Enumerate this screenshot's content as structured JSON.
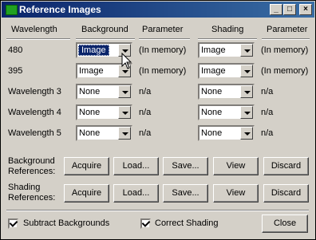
{
  "window": {
    "title": "Reference Images",
    "minimize_label": "_",
    "maximize_label": "□",
    "close_label": "×"
  },
  "headers": {
    "wavelength": "Wavelength",
    "background": "Background",
    "parameter1": "Parameter",
    "shading": "Shading",
    "parameter2": "Parameter"
  },
  "rows": [
    {
      "wavelength": "480",
      "background": "Image",
      "bg_param": "(In memory)",
      "shading": "Image",
      "sh_param": "(In memory)"
    },
    {
      "wavelength": "395",
      "background": "Image",
      "bg_param": "(In memory)",
      "shading": "Image",
      "sh_param": "(In memory)"
    },
    {
      "wavelength": "Wavelength 3",
      "background": "None",
      "bg_param": "n/a",
      "shading": "None",
      "sh_param": "n/a"
    },
    {
      "wavelength": "Wavelength 4",
      "background": "None",
      "bg_param": "n/a",
      "shading": "None",
      "sh_param": "n/a"
    },
    {
      "wavelength": "Wavelength 5",
      "background": "None",
      "bg_param": "n/a",
      "shading": "None",
      "sh_param": "n/a"
    }
  ],
  "background_refs": {
    "label_line1": "Background",
    "label_line2": "References:",
    "acquire": "Acquire",
    "load": "Load...",
    "save": "Save...",
    "view": "View",
    "discard": "Discard"
  },
  "shading_refs": {
    "label_line1": "Shading",
    "label_line2": "References:",
    "acquire": "Acquire",
    "load": "Load...",
    "save": "Save...",
    "view": "View",
    "discard": "Discard"
  },
  "footer": {
    "subtract_backgrounds": "Subtract Backgrounds",
    "subtract_checked": true,
    "correct_shading": "Correct Shading",
    "correct_checked": true,
    "close": "Close"
  }
}
